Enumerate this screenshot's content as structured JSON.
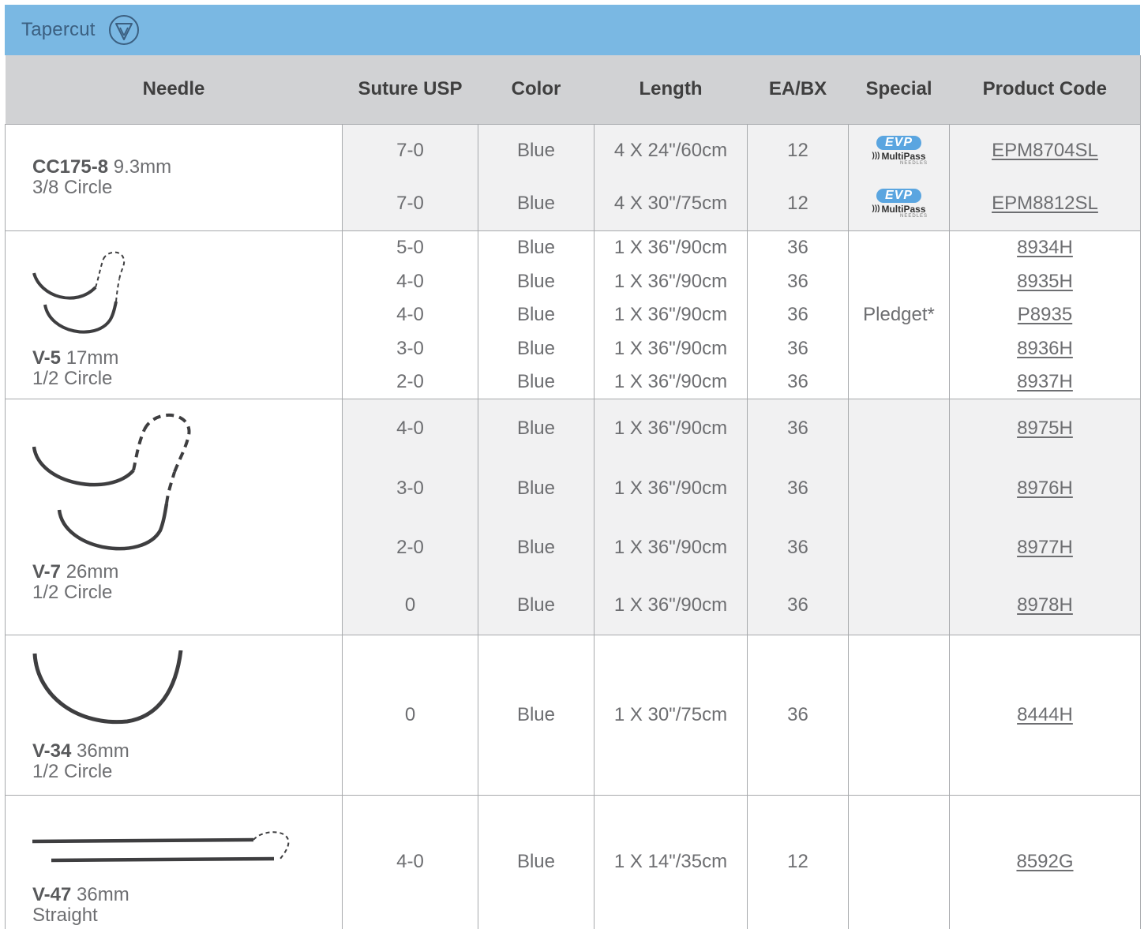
{
  "banner": {
    "title": "Tapercut",
    "icon": "tapercut-triangle-icon"
  },
  "headers": [
    "Needle",
    "Suture USP",
    "Color",
    "Length",
    "EA/BX",
    "Special",
    "Product Code"
  ],
  "groups": [
    {
      "needle": {
        "code": "CC175-8",
        "size": "9.3mm",
        "shape": "3/8 Circle",
        "icon": "none"
      },
      "rows": [
        {
          "usp": "7-0",
          "color": "Blue",
          "length": "4 X 24\"/60cm",
          "ea": "12",
          "special_badge": "EVP",
          "special_brand": "MultiPass",
          "special_sub": "NEEDLES",
          "code": "EPM8704SL"
        },
        {
          "usp": "7-0",
          "color": "Blue",
          "length": "4 X 30\"/75cm",
          "ea": "12",
          "special_badge": "EVP",
          "special_brand": "MultiPass",
          "special_sub": "NEEDLES",
          "code": "EPM8812SL"
        }
      ]
    },
    {
      "needle": {
        "code": "V-5",
        "size": "17mm",
        "shape": "1/2 Circle",
        "icon": "half-circle-double-needle-icon"
      },
      "special": "Pledget*",
      "rows": [
        {
          "usp": "5-0",
          "color": "Blue",
          "length": "1 X 36\"/90cm",
          "ea": "36",
          "code": "8934H"
        },
        {
          "usp": "4-0",
          "color": "Blue",
          "length": "1 X 36\"/90cm",
          "ea": "36",
          "code": "8935H"
        },
        {
          "usp": "4-0",
          "color": "Blue",
          "length": "1 X 36\"/90cm",
          "ea": "36",
          "code": "P8935"
        },
        {
          "usp": "3-0",
          "color": "Blue",
          "length": "1 X 36\"/90cm",
          "ea": "36",
          "code": "8936H"
        },
        {
          "usp": "2-0",
          "color": "Blue",
          "length": "1 X 36\"/90cm",
          "ea": "36",
          "code": "8937H"
        }
      ]
    },
    {
      "needle": {
        "code": "V-7",
        "size": "26mm",
        "shape": "1/2 Circle",
        "icon": "half-circle-double-needle-icon"
      },
      "rows": [
        {
          "usp": "4-0",
          "color": "Blue",
          "length": "1 X 36\"/90cm",
          "ea": "36",
          "code": "8975H"
        },
        {
          "usp": "3-0",
          "color": "Blue",
          "length": "1 X 36\"/90cm",
          "ea": "36",
          "code": "8976H"
        },
        {
          "usp": "2-0",
          "color": "Blue",
          "length": "1 X 36\"/90cm",
          "ea": "36",
          "code": "8977H"
        },
        {
          "usp": "0",
          "color": "Blue",
          "length": "1 X 36\"/90cm",
          "ea": "36",
          "code": "8978H"
        }
      ]
    },
    {
      "needle": {
        "code": "V-34",
        "size": "36mm",
        "shape": "1/2 Circle",
        "icon": "half-circle-needle-icon"
      },
      "rows": [
        {
          "usp": "0",
          "color": "Blue",
          "length": "1 X 30\"/75cm",
          "ea": "36",
          "code": "8444H"
        }
      ]
    },
    {
      "needle": {
        "code": "V-47",
        "size": "36mm",
        "shape": "Straight",
        "icon": "straight-double-needle-icon"
      },
      "rows": [
        {
          "usp": "4-0",
          "color": "Blue",
          "length": "1 X 14\"/35cm",
          "ea": "12",
          "code": "8592G"
        }
      ]
    }
  ],
  "colors": {
    "banner": "#7ab8e3",
    "header_bg": "#d1d2d4",
    "shade": "#f1f1f2",
    "evp": "#5aa5e0"
  }
}
